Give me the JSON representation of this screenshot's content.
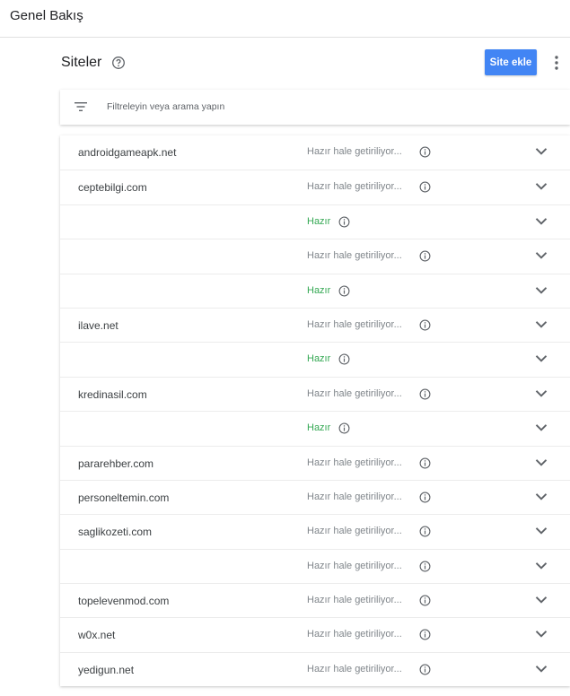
{
  "topbar": {
    "title": "Genel Bakış"
  },
  "header": {
    "title": "Siteler",
    "add_button": "Site ekle"
  },
  "filter": {
    "placeholder": "Filtreleyin veya arama yapın"
  },
  "rows": [
    {
      "domain": "androidgameapk.net",
      "status": "Hazır hale getiriliyor...",
      "state": "pending"
    },
    {
      "domain": "ceptebilgi.com",
      "status": "Hazır hale getiriliyor...",
      "state": "pending"
    },
    {
      "domain": "",
      "status": "Hazır",
      "state": "ready"
    },
    {
      "domain": "",
      "status": "Hazır hale getiriliyor...",
      "state": "pending"
    },
    {
      "domain": "",
      "status": "Hazır",
      "state": "ready"
    },
    {
      "domain": "ilave.net",
      "status": "Hazır hale getiriliyor...",
      "state": "pending"
    },
    {
      "domain": "",
      "status": "Hazır",
      "state": "ready"
    },
    {
      "domain": "kredinasil.com",
      "status": "Hazır hale getiriliyor...",
      "state": "pending"
    },
    {
      "domain": "",
      "status": "Hazır",
      "state": "ready"
    },
    {
      "domain": "pararehber.com",
      "status": "Hazır hale getiriliyor...",
      "state": "pending"
    },
    {
      "domain": "personeltemin.com",
      "status": "Hazır hale getiriliyor...",
      "state": "pending"
    },
    {
      "domain": "saglikozeti.com",
      "status": "Hazır hale getiriliyor...",
      "state": "pending"
    },
    {
      "domain": "",
      "status": "Hazır hale getiriliyor...",
      "state": "pending"
    },
    {
      "domain": "topelevenmod.com",
      "status": "Hazır hale getiriliyor...",
      "state": "pending"
    },
    {
      "domain": "w0x.net",
      "status": "Hazır hale getiriliyor...",
      "state": "pending"
    },
    {
      "domain": "yedigun.net",
      "status": "Hazır hale getiriliyor...",
      "state": "pending"
    }
  ],
  "icons": {
    "help": "help-circle-icon",
    "more": "more-vert-icon",
    "filter": "filter-icon",
    "info": "info-icon",
    "expand": "chevron-down-icon"
  },
  "colors": {
    "accent": "#4285f4",
    "ready": "#34a853",
    "pending": "#80868b"
  }
}
